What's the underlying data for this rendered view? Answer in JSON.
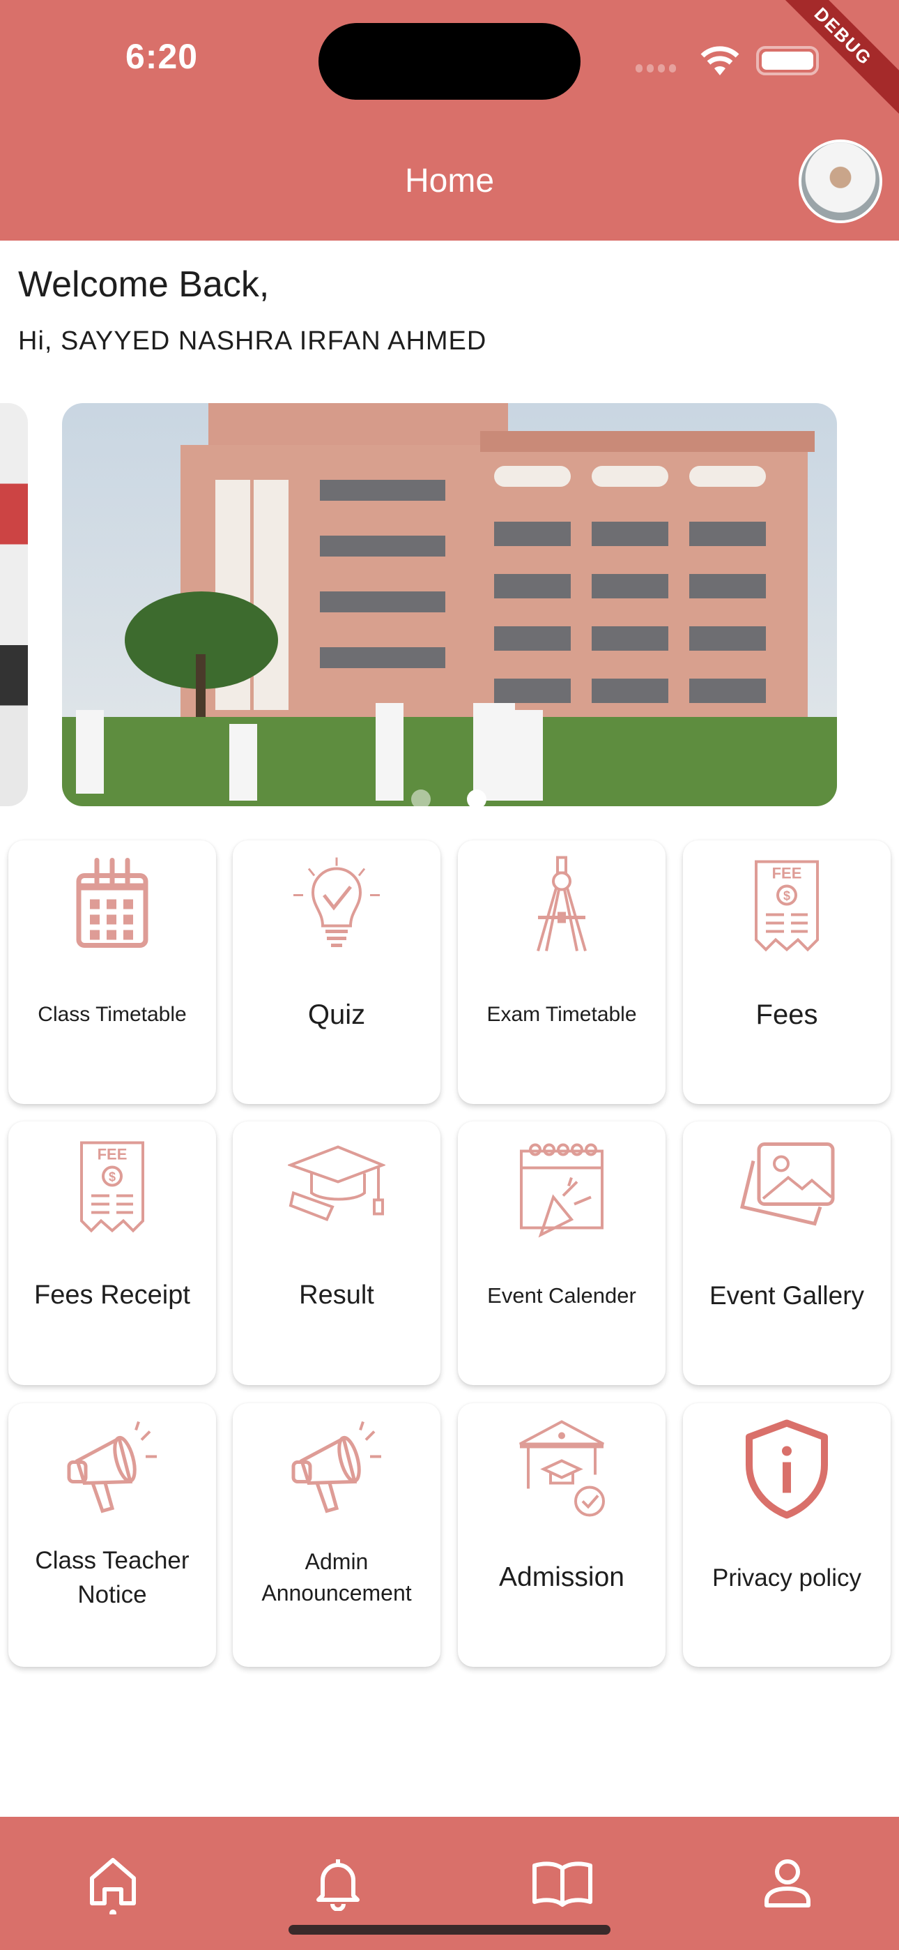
{
  "status_bar": {
    "time": "6:20",
    "debug_banner": "DEBUG"
  },
  "header": {
    "title": "Home"
  },
  "greeting": {
    "welcome": "Welcome Back,",
    "user_line": "Hi, SAYYED NASHRA IRFAN AHMED"
  },
  "carousel": {
    "active_index": 1,
    "count": 2
  },
  "grid": [
    {
      "label": "Class Timetable",
      "icon": "calendar-icon",
      "size": 30
    },
    {
      "label": "Quiz",
      "icon": "lightbulb-check-icon",
      "size": 40
    },
    {
      "label": "Exam Timetable",
      "icon": "compass-icon",
      "size": 30
    },
    {
      "label": "Fees",
      "icon": "fee-receipt-icon",
      "size": 40
    },
    {
      "label": "Fees Receipt",
      "icon": "fee-receipt-icon",
      "size": 38
    },
    {
      "label": "Result",
      "icon": "graduation-cap-icon",
      "size": 38
    },
    {
      "label": "Event Calender",
      "icon": "event-calendar-icon",
      "size": 31
    },
    {
      "label": "Event Gallery",
      "icon": "gallery-icon",
      "size": 37
    },
    {
      "label": "Class Teacher Notice",
      "icon": "megaphone-icon",
      "size": 35
    },
    {
      "label": "Admin Announcement",
      "icon": "megaphone-icon",
      "size": 32
    },
    {
      "label": "Admission",
      "icon": "school-check-icon",
      "size": 39
    },
    {
      "label": "Privacy policy",
      "icon": "shield-info-icon",
      "size": 35
    }
  ],
  "bottom_nav": [
    {
      "name": "home",
      "icon": "home-icon",
      "active": true
    },
    {
      "name": "notifications",
      "icon": "bell-icon"
    },
    {
      "name": "library",
      "icon": "book-icon"
    },
    {
      "name": "profile",
      "icon": "person-icon"
    }
  ],
  "colors": {
    "primary": "#D9706A",
    "icon": "#DE9C96",
    "text": "#1E1E1E",
    "debug": "#A52A2A"
  }
}
